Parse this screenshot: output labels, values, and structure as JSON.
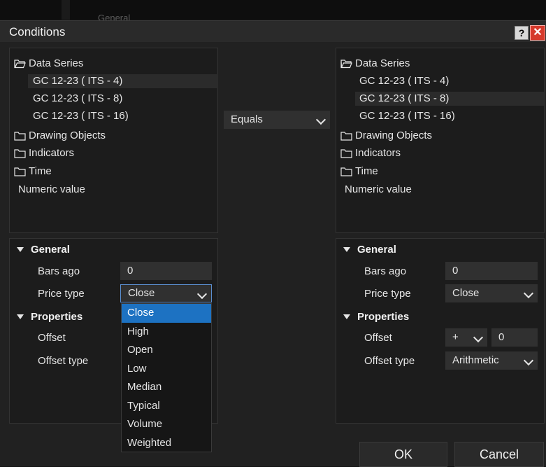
{
  "background": {
    "partial_label": "General"
  },
  "dialog": {
    "title": "Conditions",
    "help_label": "?",
    "close_label": "✕"
  },
  "left": {
    "tree": {
      "data_series": "Data Series",
      "series": [
        "GC 12-23 ( ITS - 4)",
        "GC 12-23 ( ITS - 8)",
        "GC 12-23 ( ITS - 16)"
      ],
      "drawing_objects": "Drawing Objects",
      "indicators": "Indicators",
      "time": "Time",
      "numeric_value": "Numeric value"
    },
    "general": {
      "header": "General",
      "bars_ago_label": "Bars ago",
      "bars_ago_value": "0",
      "price_type_label": "Price type",
      "price_type_value": "Close"
    },
    "properties": {
      "header": "Properties",
      "offset_label": "Offset",
      "offset_type_label": "Offset type"
    },
    "price_type_options": [
      "Close",
      "High",
      "Open",
      "Low",
      "Median",
      "Typical",
      "Volume",
      "Weighted"
    ]
  },
  "operator": {
    "value": "Equals"
  },
  "right": {
    "tree": {
      "data_series": "Data Series",
      "series": [
        "GC 12-23 ( ITS - 4)",
        "GC 12-23 ( ITS - 8)",
        "GC 12-23 ( ITS - 16)"
      ],
      "drawing_objects": "Drawing Objects",
      "indicators": "Indicators",
      "time": "Time",
      "numeric_value": "Numeric value"
    },
    "general": {
      "header": "General",
      "bars_ago_label": "Bars ago",
      "bars_ago_value": "0",
      "price_type_label": "Price type",
      "price_type_value": "Close"
    },
    "properties": {
      "header": "Properties",
      "offset_label": "Offset",
      "offset_sign": "+",
      "offset_value": "0",
      "offset_type_label": "Offset type",
      "offset_type_value": "Arithmetic"
    }
  },
  "footer": {
    "ok_label": "OK",
    "cancel_label": "Cancel"
  }
}
